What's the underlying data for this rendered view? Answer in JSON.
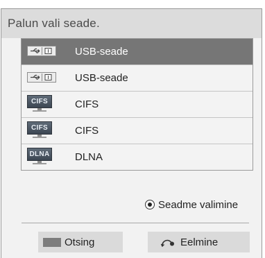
{
  "dialog": {
    "title": "Palun vali seade."
  },
  "devices": [
    {
      "label": "USB-seade",
      "icon": "usb-storage-icon",
      "selected": true
    },
    {
      "label": "USB-seade",
      "icon": "usb-storage-icon",
      "selected": false
    },
    {
      "label": "CIFS",
      "icon": "cifs-server-icon",
      "icon_text": "CIFS",
      "selected": false
    },
    {
      "label": "CIFS",
      "icon": "cifs-server-icon",
      "icon_text": "CIFS",
      "selected": false
    },
    {
      "label": "DLNA",
      "icon": "dlna-server-icon",
      "icon_text": "DLNA",
      "selected": false
    }
  ],
  "hint": {
    "icon": "ok-button-icon",
    "text": "Seadme valimine"
  },
  "footer": {
    "search_label": "Otsing",
    "search_icon": "color-key-icon",
    "back_label": "Eelmine",
    "back_icon": "back-arrow-icon"
  },
  "colors": {
    "header_bg": "#dcdcdc",
    "selected_row": "#767676",
    "row_bg": "#f3f3f3"
  }
}
